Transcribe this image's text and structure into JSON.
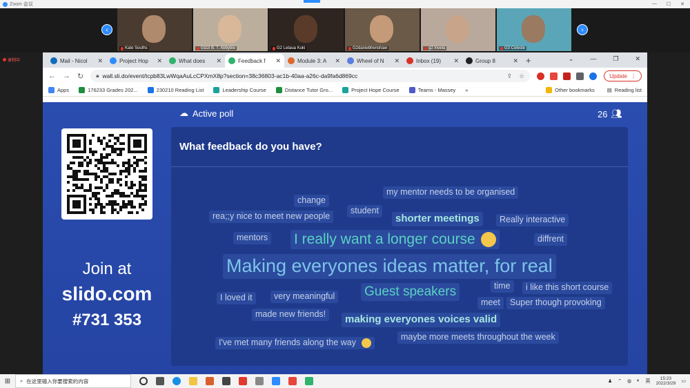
{
  "zoom": {
    "title": "Zoom 会议"
  },
  "participants": [
    {
      "name": "Kate Souths",
      "face": "#b08a6c",
      "bg": "#4a3b30"
    },
    {
      "name": "Gizzi B. T. Abbybie",
      "face": "#d9b89a",
      "bg": "#bcae9c"
    },
    {
      "name": "G2 Letaua Kuki",
      "face": "#5a3b2a",
      "bg": "#2f2520"
    },
    {
      "name": "G2daniebhenshaw",
      "face": "#c49a78",
      "bg": "#6b5a48"
    },
    {
      "name": "g2 inoela",
      "face": "#c8a48a",
      "bg": "#b9a89c"
    },
    {
      "name": "G3 Celeste",
      "face": "#9a7a60",
      "bg": "#5aa6b8"
    }
  ],
  "recording_label": "录制中",
  "browser": {
    "tabs": [
      {
        "title": "Mail - Nicol",
        "color": "#0f6cbd",
        "active": false
      },
      {
        "title": "Project Hop",
        "color": "#2d8cff",
        "active": false
      },
      {
        "title": "What does",
        "color": "#2fb36d",
        "active": false
      },
      {
        "title": "Feedback f",
        "color": "#2fb36d",
        "active": true
      },
      {
        "title": "Module 3: A",
        "color": "#e0682d",
        "active": false
      },
      {
        "title": "Wheel of N",
        "color": "#5b7ce0",
        "active": false
      },
      {
        "title": "Inbox (19)",
        "color": "#d93025",
        "active": false
      },
      {
        "title": "Group 8",
        "color": "#222222",
        "active": false
      }
    ],
    "url": "wall.sli.do/event/tcpb83LwWqaAuLcCPXmX8p?section=38c36803-ac1b-40aa-a26c-da9fa6d869cc",
    "update_label": "Update",
    "bookmarks": [
      {
        "label": "Apps",
        "color": "#4285f4"
      },
      {
        "label": "176233 Grades 202...",
        "color": "#1e8e3e"
      },
      {
        "label": "230210 Reading List",
        "color": "#1a73e8"
      },
      {
        "label": "Leadership Course",
        "color": "#1aa39b"
      },
      {
        "label": "Distance Tutor Gro...",
        "color": "#1e8e3e"
      },
      {
        "label": "Project Hope Course",
        "color": "#1aa39b"
      },
      {
        "label": "Teams - Massey",
        "color": "#5059c9"
      }
    ],
    "bookmarks_more": "»",
    "other_bookmarks": "Other bookmarks",
    "reading_list": "Reading list"
  },
  "slido": {
    "active_poll": "Active poll",
    "participants_count": "26",
    "question": "What feedback do you have?",
    "join_line1": "Join at",
    "join_line2": "slido.com",
    "join_line3": "#731 353",
    "words": [
      "change",
      "my mentor needs to be organised",
      "student",
      "rea;;y nice to meet new people",
      "shorter meetings",
      "Really interactive",
      "mentors",
      "I really want a longer course",
      "diffrent",
      "Making everyones ideas matter, for real",
      "time",
      "i like this short course",
      "I loved it",
      "very meaningful",
      "Guest speakers",
      "meet",
      "Super though provoking",
      "made new friends!",
      "making everyones voices valid",
      "I've met many friends along the way",
      "maybe more meets throughout the week"
    ]
  },
  "taskbar": {
    "search_placeholder": "在这里输入你要搜索的内容",
    "ime": "英",
    "time": "15:23",
    "date": "2022/3/29"
  }
}
